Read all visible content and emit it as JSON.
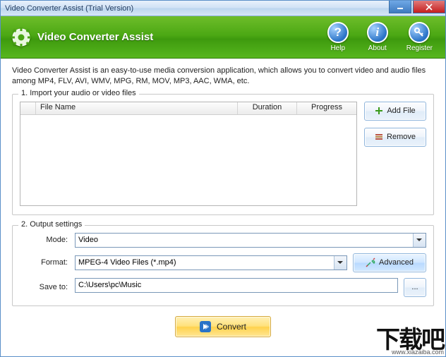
{
  "window": {
    "title": "Video Converter Assist (Trial Version)"
  },
  "header": {
    "appName": "Video Converter Assist",
    "actions": {
      "help": "Help",
      "about": "About",
      "register": "Register"
    }
  },
  "description": "Video Converter Assist is an easy-to-use media conversion application, which allows you to convert video and audio files among MP4, FLV, AVI, WMV, MPG, RM, MOV, MP3, AAC, WMA, etc.",
  "import": {
    "legend": "1. Import your audio or video files",
    "columns": {
      "fileName": "File Name",
      "duration": "Duration",
      "progress": "Progress"
    },
    "addFile": "Add File",
    "remove": "Remove"
  },
  "output": {
    "legend": "2. Output settings",
    "modeLabel": "Mode:",
    "modeValue": "Video",
    "formatLabel": "Format:",
    "formatValue": "MPEG-4 Video Files (*.mp4)",
    "advanced": "Advanced",
    "saveToLabel": "Save to:",
    "saveToValue": "C:\\Users\\pc\\Music",
    "browse": "..."
  },
  "convert": "Convert",
  "watermark": {
    "text": "下载吧",
    "url": "www.xiazaiba.com"
  }
}
